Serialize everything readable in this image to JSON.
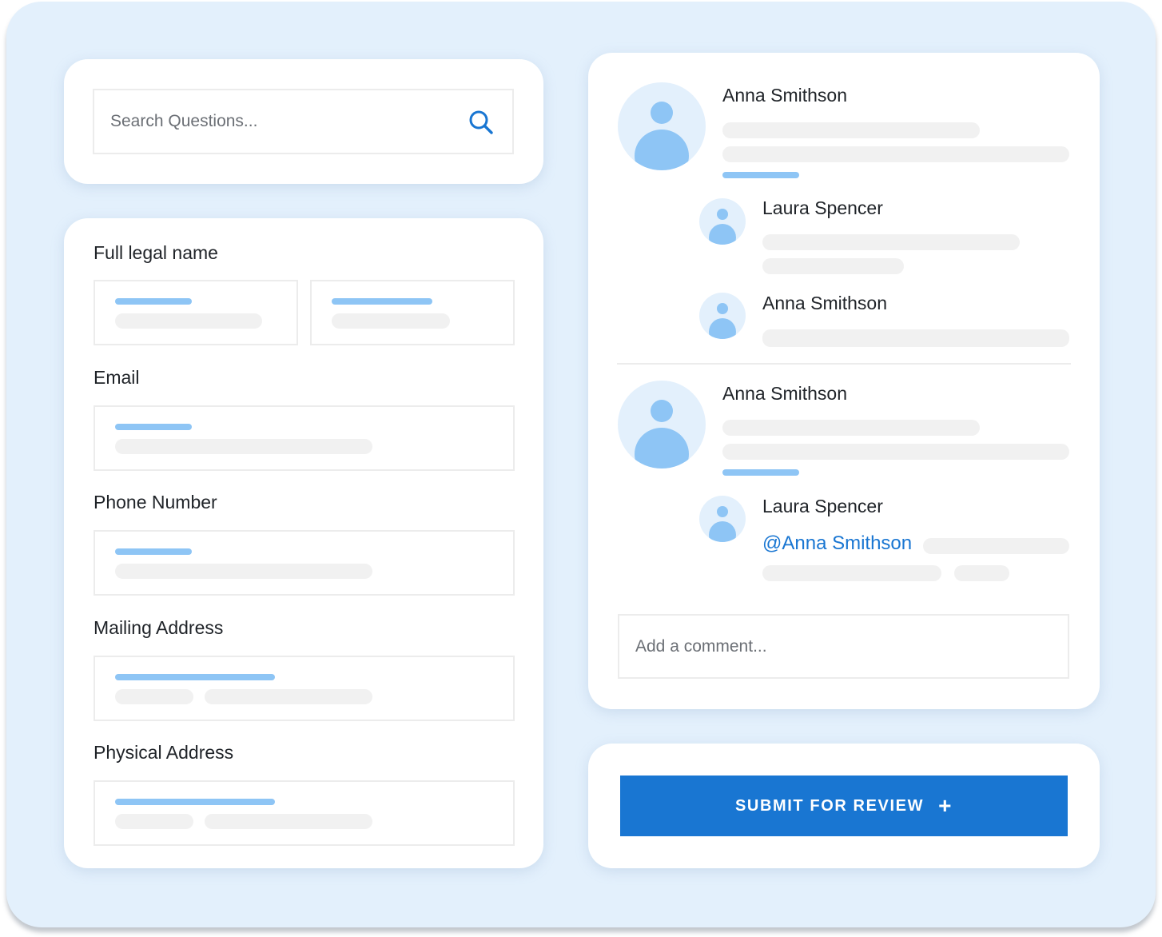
{
  "search": {
    "placeholder": "Search Questions...",
    "icon": "search-icon"
  },
  "form": {
    "fields": [
      {
        "label": "Full legal name"
      },
      {
        "label": "Email"
      },
      {
        "label": "Phone Number"
      },
      {
        "label": "Mailing Address"
      },
      {
        "label": "Physical Address"
      }
    ]
  },
  "thread": {
    "comments": [
      {
        "author": "Anna Smithson",
        "replies": [
          {
            "author": "Laura Spencer"
          },
          {
            "author": "Anna Smithson"
          }
        ]
      },
      {
        "author": "Anna Smithson",
        "replies": [
          {
            "author": "Laura Spencer",
            "mention": "@Anna Smithson"
          }
        ]
      }
    ],
    "comment_placeholder": "Add a comment..."
  },
  "submit": {
    "label": "SUBMIT FOR REVIEW",
    "icon": "plus-icon"
  },
  "colors": {
    "accent": "#1976d2",
    "accent_light": "#8ec5f5",
    "background": "#e3f0fc",
    "skeleton": "#f1f1f1"
  }
}
